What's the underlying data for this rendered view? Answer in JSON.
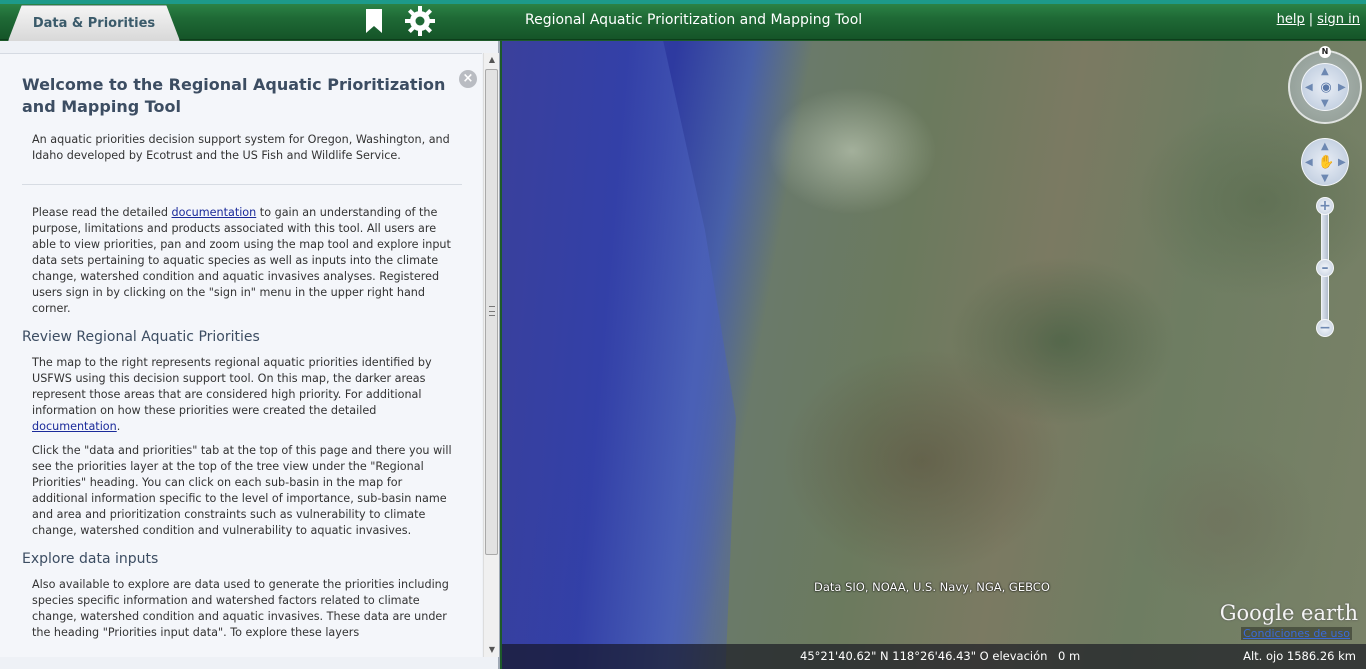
{
  "header": {
    "tab_label": "Data & Priorities",
    "title": "Regional Aquatic Prioritization and Mapping Tool",
    "help_link": "help",
    "separator": "|",
    "signin_link": "sign in",
    "icons": [
      "bookmark-icon",
      "gear-icon"
    ]
  },
  "panel": {
    "close_symbol": "×",
    "welcome_title": "Welcome to the Regional Aquatic Prioritization and Mapping Tool",
    "intro": "An aquatic priorities decision support system for Oregon, Washington, and Idaho developed by Ecotrust and the US Fish and Wildlife Service.",
    "read_before": "Please read the detailed ",
    "documentation_link": "documentation",
    "read_after": " to gain an understanding of the purpose, limitations and products associated with this tool. All users are able to view priorities, pan and zoom using the map tool and explore input data sets pertaining to aquatic species as well as inputs into the climate change, watershed condition and aquatic invasives analyses. Registered users sign in by clicking on the \"sign in\" menu in the upper right hand corner.",
    "review_heading": "Review Regional Aquatic Priorities",
    "review_before": "The map to the right represents regional aquatic priorities identified by USFWS using this decision support tool. On this map, the darker areas represent those areas that are considered high priority. For additional information on how these priorities were created the detailed ",
    "review_link": "documentation",
    "review_after": ".",
    "click_para": "Click the \"data and priorities\" tab at the top of this page and there you will see the priorities layer at the top of the tree view under the \"Regional Priorities\" heading. You can click on each sub-basin in the map for additional information specific to the level of importance, sub-basin name and area and prioritization constraints such as vulnerability to climate change, watershed condition and vulnerability to aquatic invasives.",
    "explore_heading": "Explore data inputs",
    "explore_para": "Also available to explore are data used to generate the priorities including species specific information and watershed factors related to climate change, watershed condition and aquatic invasives. These data are under the heading \"Priorities input data\". To explore these layers"
  },
  "map": {
    "credit": "Data SIO, NOAA, U.S. Navy, NGA, GEBCO",
    "logo": "Google earth",
    "terms_link": "Condiciones de uso",
    "coords": "45°21'40.62\" N 118°26'46.43\" O elevación",
    "elevation": "0 m",
    "eye_alt": "Alt. ojo  1586.26 km",
    "north": "N",
    "zoom_in": "+",
    "zoom_out": "−",
    "zoom_level": 0.5
  },
  "colors": {
    "header_green": "#1f6a36",
    "link_blue": "#1a2a9a",
    "water_blue": "#3340a8"
  }
}
